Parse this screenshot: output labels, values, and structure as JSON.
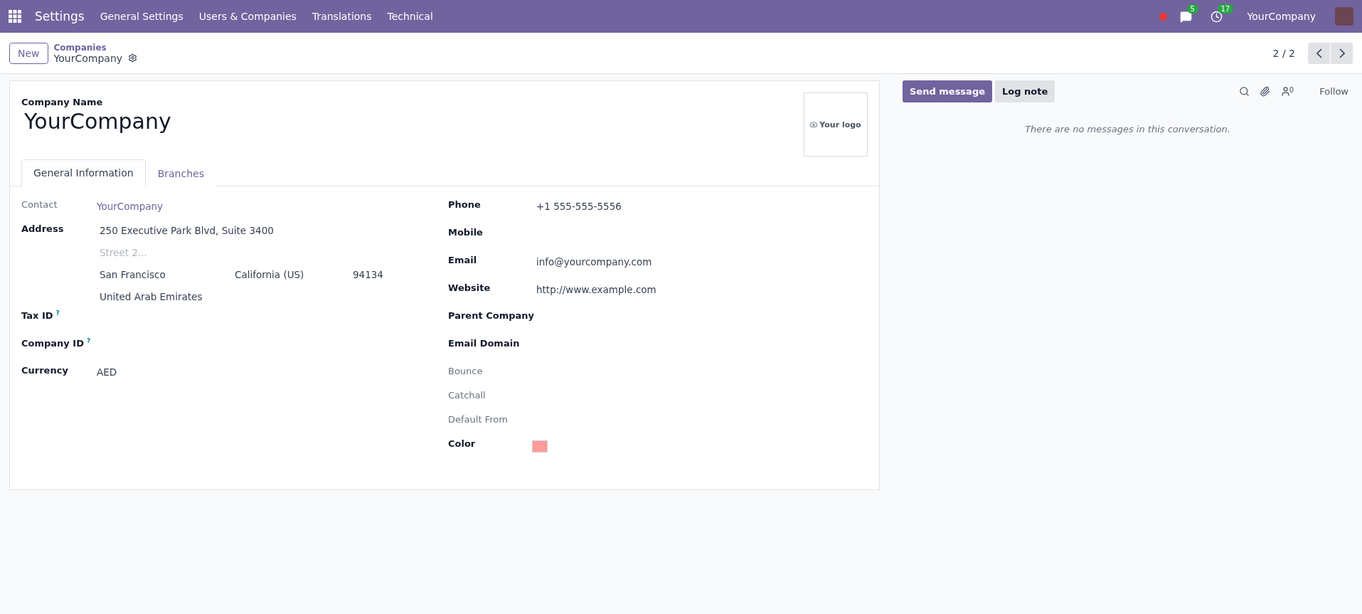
{
  "navbar": {
    "app_name": "Settings",
    "menu": [
      "General Settings",
      "Users & Companies",
      "Translations",
      "Technical"
    ],
    "messages_count": "5",
    "activities_count": "17",
    "company": "YourCompany"
  },
  "control_panel": {
    "new_button": "New",
    "breadcrumb_parent": "Companies",
    "breadcrumb_current": "YourCompany",
    "pager": "2 / 2"
  },
  "form": {
    "name_label": "Company Name",
    "name": "YourCompany",
    "logo_text": "Your logo",
    "tabs": [
      {
        "label": "General Information",
        "selected": true
      },
      {
        "label": "Branches",
        "selected": false
      }
    ],
    "left_fields": [
      {
        "kind": "link",
        "label": "Contact",
        "muted": true,
        "value": "YourCompany"
      },
      {
        "kind": "address",
        "label": "Address",
        "muted": false,
        "street": "250 Executive Park Blvd, Suite 3400",
        "street2_placeholder": "Street 2...",
        "city": "San Francisco",
        "state": "California (US)",
        "zip": "94134",
        "country": "United Arab Emirates"
      },
      {
        "kind": "text",
        "label": "Tax ID",
        "muted": false,
        "help": "?"
      },
      {
        "kind": "text",
        "label": "Company ID",
        "muted": false,
        "help": "?"
      },
      {
        "kind": "text",
        "label": "Currency",
        "muted": false,
        "value": "AED"
      }
    ],
    "right_fields": [
      {
        "kind": "text",
        "label": "Phone",
        "muted": false,
        "value": "+1 555-555-5556"
      },
      {
        "kind": "text",
        "label": "Mobile",
        "muted": false
      },
      {
        "kind": "text",
        "label": "Email",
        "muted": false,
        "value": "info@yourcompany.com"
      },
      {
        "kind": "text",
        "label": "Website",
        "muted": false,
        "value": "http://www.example.com"
      },
      {
        "kind": "text",
        "label": "Parent Company",
        "muted": false
      },
      {
        "kind": "text",
        "label": "Email Domain",
        "muted": false
      },
      {
        "kind": "text",
        "label": "Bounce",
        "muted": true
      },
      {
        "kind": "text",
        "label": "Catchall",
        "muted": true
      },
      {
        "kind": "text",
        "label": "Default From",
        "muted": true
      },
      {
        "kind": "color",
        "label": "Color",
        "muted": false,
        "color": "#ff9c9c"
      }
    ]
  },
  "chatter": {
    "send_button": "Send message",
    "log_button": "Log note",
    "followers_count": "0",
    "follow": "Follow",
    "empty_text": "There are no messages in this conversation."
  }
}
